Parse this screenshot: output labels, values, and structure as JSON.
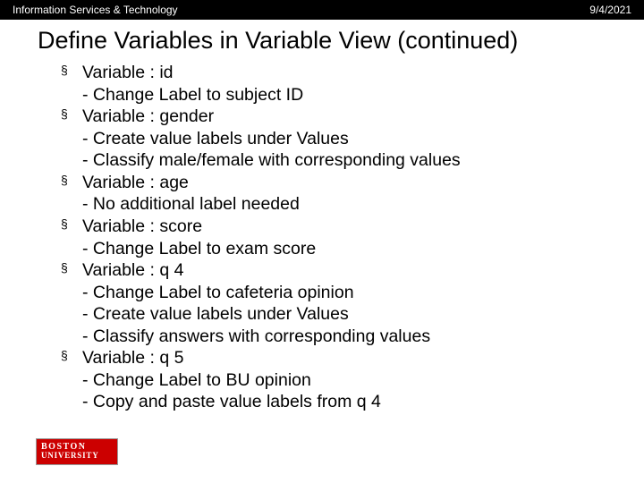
{
  "topbar": {
    "left": "Information Services & Technology",
    "right": "9/4/2021"
  },
  "title": "Define Variables in Variable View (continued)",
  "items": [
    {
      "head": "Variable : id",
      "subs": [
        "- Change Label to subject ID"
      ]
    },
    {
      "head": "Variable : gender",
      "subs": [
        "- Create value labels under Values",
        "- Classify male/female with corresponding values"
      ]
    },
    {
      "head": "Variable : age",
      "subs": [
        "- No additional label needed"
      ]
    },
    {
      "head": "Variable : score",
      "subs": [
        "- Change Label to exam score"
      ]
    },
    {
      "head": "Variable : q 4",
      "subs": [
        "- Change Label to cafeteria opinion",
        "- Create value labels under Values",
        "- Classify answers with corresponding values"
      ]
    },
    {
      "head": "Variable : q 5",
      "subs": [
        "- Change Label to BU opinion",
        "- Copy and paste value labels from q 4"
      ]
    }
  ],
  "logo": {
    "line1": "BOSTON",
    "line2": "UNIVERSITY"
  }
}
